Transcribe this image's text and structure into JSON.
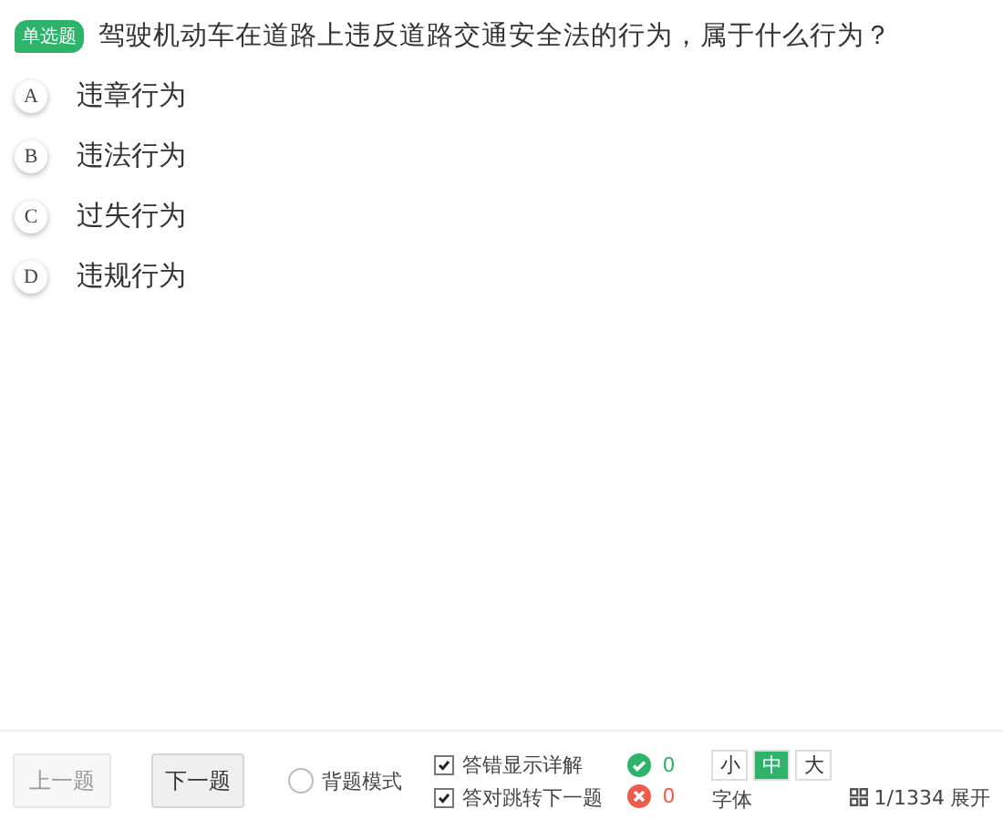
{
  "question": {
    "badge": "单选题",
    "text": "驾驶机动车在道路上违反道路交通安全法的行为，属于什么行为？"
  },
  "options": [
    {
      "letter": "A",
      "text": "违章行为",
      "selected": false
    },
    {
      "letter": "B",
      "text": "违法行为",
      "selected": false
    },
    {
      "letter": "C",
      "text": "过失行为",
      "selected": false
    },
    {
      "letter": "D",
      "text": "违规行为",
      "selected": false
    }
  ],
  "footer": {
    "prev": {
      "label": "上一题",
      "disabled": true
    },
    "next": {
      "label": "下一题",
      "disabled": false
    },
    "mode": {
      "label": "背题模式",
      "checked": false
    },
    "checks": [
      {
        "label": "答错显示详解",
        "checked": true
      },
      {
        "label": "答对跳转下一题",
        "checked": true
      }
    ],
    "correct": "0",
    "wrong": "0",
    "sizes": [
      {
        "label": "小",
        "selected": false
      },
      {
        "label": "中",
        "selected": true
      },
      {
        "label": "大",
        "selected": false
      }
    ],
    "size_caption": "字体",
    "progress": "1/1334",
    "expand": "展开"
  }
}
